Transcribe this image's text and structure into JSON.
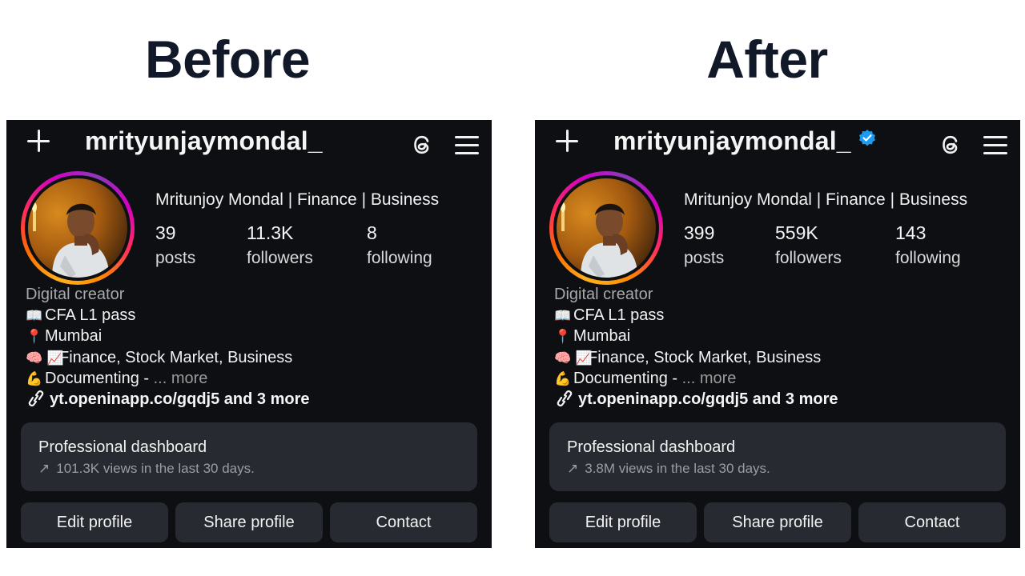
{
  "headings": {
    "before": "Before",
    "after": "After"
  },
  "before": {
    "username": "mrityunjaymondal_",
    "full_name": "Mritunjoy Mondal  | Finance | Business",
    "stats": [
      {
        "num": "39",
        "label": "posts"
      },
      {
        "num": "11.3K",
        "label": "followers"
      },
      {
        "num": "8",
        "label": "following"
      }
    ],
    "category": "Digital creator",
    "bio": [
      {
        "emoji": "📖",
        "text": "CFA L1 pass"
      },
      {
        "emoji": "📍",
        "text": "Mumbai"
      },
      {
        "emoji": "🧠 📈",
        "text": "Finance, Stock Market, Business"
      },
      {
        "emoji": "💪",
        "text": "Documenting - ",
        "more": "... more"
      }
    ],
    "link": "yt.openinapp.co/gqdj5 and 3 more",
    "dashboard": {
      "title": "Professional dashboard",
      "subtitle": "101.3K views in the last 30 days."
    },
    "buttons": {
      "edit": "Edit profile",
      "share": "Share profile",
      "contact": "Contact"
    }
  },
  "after": {
    "username": "mrityunjaymondal_",
    "verified": true,
    "full_name": "Mritunjoy Mondal  | Finance | Business",
    "stats": [
      {
        "num": "399",
        "label": "posts"
      },
      {
        "num": "559K",
        "label": "followers"
      },
      {
        "num": "143",
        "label": "following"
      }
    ],
    "category": "Digital creator",
    "bio": [
      {
        "emoji": "📖",
        "text": "CFA L1 pass"
      },
      {
        "emoji": "📍",
        "text": "Mumbai"
      },
      {
        "emoji": "🧠 📈",
        "text": "Finance, Stock Market, Business"
      },
      {
        "emoji": "💪",
        "text": "Documenting - ",
        "more": "... more"
      }
    ],
    "link": "yt.openinapp.co/gqdj5 and 3 more",
    "dashboard": {
      "title": "Professional dashboard",
      "subtitle": "3.8M views in the last 30 days."
    },
    "buttons": {
      "edit": "Edit profile",
      "share": "Share profile",
      "contact": "Contact"
    }
  },
  "colors": {
    "panel_bg": "#0d0f13",
    "card_bg": "#272a30",
    "verified_blue": "#1d9bf0",
    "heading": "#111827"
  },
  "icons": {
    "new_post": "plus-icon",
    "threads": "threads-icon",
    "menu": "hamburger-menu-icon",
    "link": "link-icon",
    "verified": "verified-badge-icon"
  }
}
